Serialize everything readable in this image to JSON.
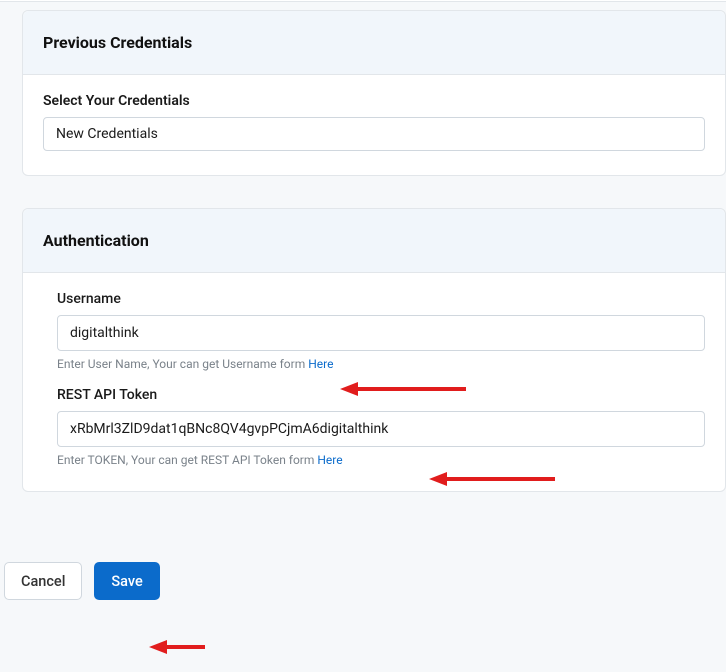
{
  "previousCredentials": {
    "title": "Previous Credentials",
    "selectLabel": "Select Your Credentials",
    "selectedValue": "New Credentials"
  },
  "authentication": {
    "title": "Authentication",
    "username": {
      "label": "Username",
      "value": "digitalthink",
      "helpPrefix": "Enter User Name, Your can get Username form ",
      "helpLink": "Here"
    },
    "token": {
      "label": "REST API Token",
      "value": "xRbMrl3ZlD9dat1qBNc8QV4gvpPCjmA6digitalthink",
      "helpPrefix": "Enter TOKEN, Your can get REST API Token form ",
      "helpLink": "Here"
    }
  },
  "buttons": {
    "cancel": "Cancel",
    "save": "Save"
  }
}
